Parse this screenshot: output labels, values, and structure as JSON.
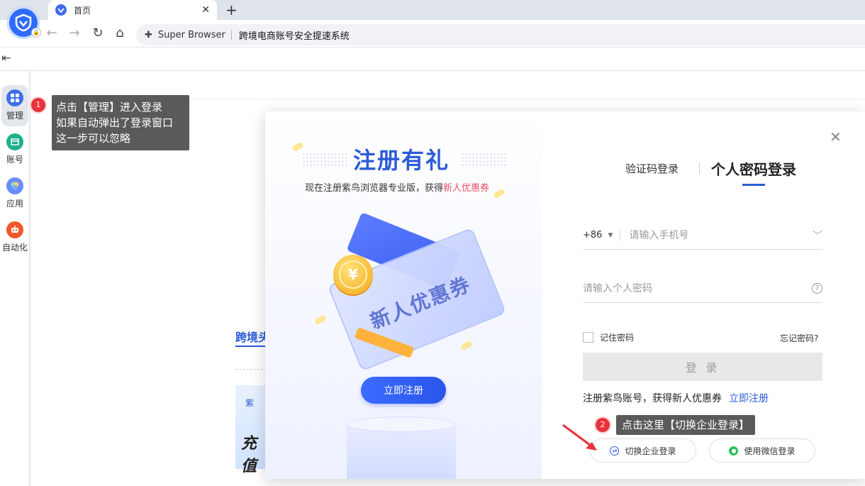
{
  "browser": {
    "tab_title": "首页",
    "tab_close": "✕",
    "new_tab": "+",
    "site_label": "Super Browser",
    "page_title": "跨境电商账号安全提速系统"
  },
  "sidebar": {
    "items": [
      {
        "label": "管理",
        "icon": "grid-icon",
        "color": "#3f6fe6"
      },
      {
        "label": "账号",
        "icon": "window-icon",
        "color": "#20b28a"
      },
      {
        "label": "应用",
        "icon": "apps-icon",
        "color": "#6a8cff"
      },
      {
        "label": "自动化",
        "icon": "robot-icon",
        "color": "#f0592a"
      }
    ]
  },
  "annotations": {
    "step1_number": "1",
    "step1_text": [
      "点击【管理】进入登录",
      "如果自动弹出了登录窗口",
      "这一步可以忽略"
    ],
    "step2_number": "2",
    "step2_text": "点击这里【切换企业登录】"
  },
  "background": {
    "section_heading": "跨境头",
    "card_brand": "紫",
    "card_text": "充值"
  },
  "promo": {
    "headline": "注册有礼",
    "sub_prefix": "现在注册紫鸟浏览器专业版，获得",
    "sub_highlight": "新人优惠券",
    "ticket_text": "新人优惠券",
    "coin_symbol": "¥",
    "register_button": "立即注册"
  },
  "login": {
    "tab_sms": "验证码登录",
    "tab_password": "个人密码登录",
    "country_code": "+86",
    "phone_placeholder": "请输入手机号",
    "password_placeholder": "请输入个人密码",
    "remember_label": "记住密码",
    "forgot_label": "忘记密码?",
    "login_button": "登 录",
    "register_prompt": "注册紫鸟账号，获得新人优惠券",
    "register_link": "立即注册",
    "enterprise_button": "切换企业登录",
    "wechat_button": "使用微信登录"
  },
  "colors": {
    "accent": "#2c5bd8",
    "annotation_red": "#e8323c",
    "tooltip_bg": "#5a5a5a",
    "highlight_pink": "#ee4d63"
  }
}
